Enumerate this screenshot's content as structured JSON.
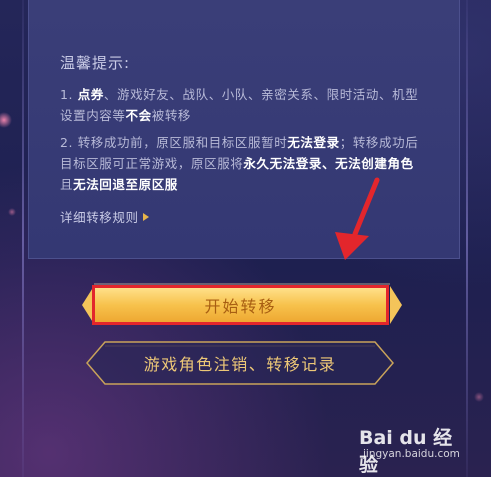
{
  "notice": {
    "title": "温馨提示:",
    "item1": {
      "p1": "1. ",
      "b1": "点券",
      "p2": "、游戏好友、战队、小队、亲密关系、限时活动、机型设置内容等",
      "b2": "不会",
      "p3": "被转移"
    },
    "item2": {
      "p1": "2. 转移成功前，原区服和目标区服暂时",
      "b1": "无法登录",
      "p2": "；转移成功后目标区服可正常游戏，原区服将",
      "b2": "永久无法登录、无法创建角色",
      "p3": "且",
      "b3": "无法回退至原区服"
    },
    "rules_link": "详细转移规则"
  },
  "buttons": {
    "start": "开始转移",
    "records": "游戏角色注销、转移记录"
  },
  "watermark": {
    "brand": "Bai du 经验",
    "url": "jingyan.baidu.com"
  },
  "colors": {
    "background": "#1d1f4a",
    "panel": "#373b76",
    "gold": "#f7c24c",
    "highlight_border": "#e3262c",
    "arrow": "#e3262c"
  },
  "icons": {
    "rules_link": "triangle-right-icon",
    "annotation": "red-arrow-icon"
  }
}
